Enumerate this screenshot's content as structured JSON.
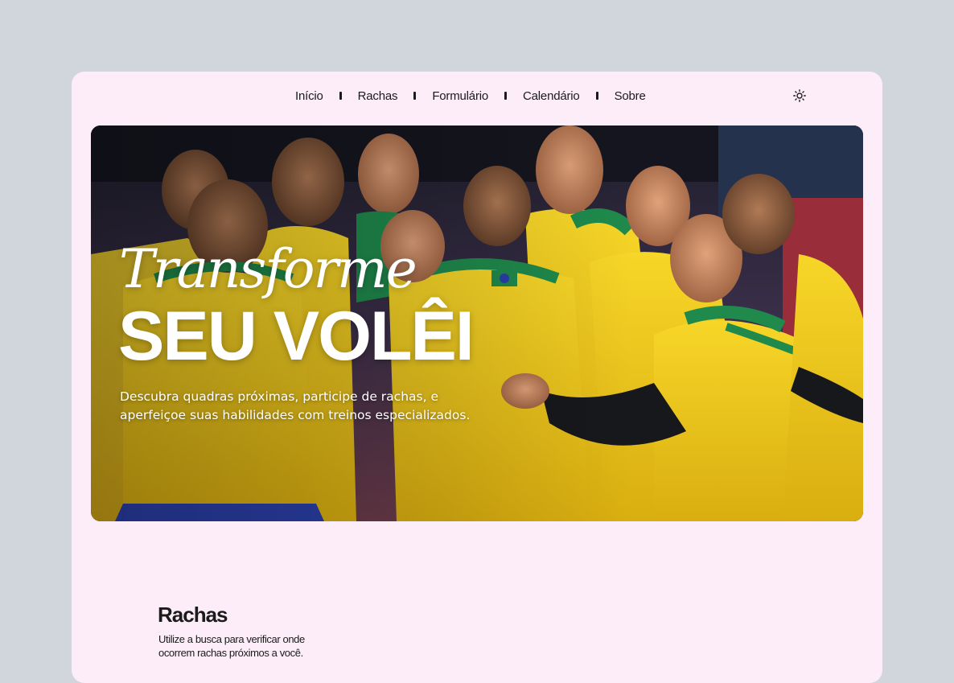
{
  "nav": {
    "items": [
      {
        "label": "Início"
      },
      {
        "label": "Rachas"
      },
      {
        "label": "Formulário"
      },
      {
        "label": "Calendário"
      },
      {
        "label": "Sobre"
      }
    ],
    "theme_icon": "sun-icon"
  },
  "hero": {
    "script": "Transforme",
    "title": "SEU VOLÊI",
    "description": "Descubra quadras próximas, participe de rachas, e aperfeiçoe suas habilidades com treinos especializados.",
    "image": "volleyball-team-celebrating-photo"
  },
  "rachas": {
    "title": "Rachas",
    "description": "Utilize a busca para verificar onde ocorrem rachas próximos a você."
  },
  "colors": {
    "page_bg": "#d1d5dc",
    "card_bg": "#fcedf8",
    "text": "#1b1b1b",
    "jersey_yellow": "#f2cc1a",
    "jersey_green": "#1f8a4c",
    "shorts_blue": "#2a3fa8"
  }
}
